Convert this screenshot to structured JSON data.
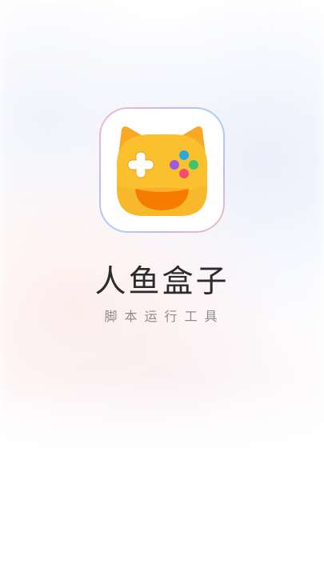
{
  "splash": {
    "app_name": "人鱼盒子",
    "tagline": "脚本运行工具",
    "logo_icon": "game-controller-cat-icon"
  },
  "colors": {
    "logo_body": "#FBC02D",
    "logo_ears": "#F9A825",
    "logo_mouth": "#F57C00",
    "dpad": "#FFFFFF",
    "btn_purple": "#9C5BE0",
    "btn_blue": "#29A8E6",
    "btn_green": "#3CC46F",
    "btn_red": "#F0506E",
    "title_text": "#2B2B2B",
    "tagline_text": "#8C8C8C"
  }
}
